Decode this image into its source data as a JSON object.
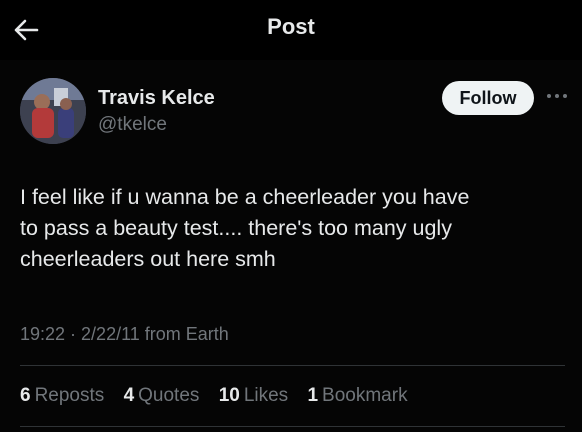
{
  "header": {
    "title": "Post",
    "back_icon": "arrow-left-icon"
  },
  "post": {
    "author": {
      "name": "Travis Kelce",
      "handle": "@tkelce"
    },
    "follow_label": "Follow",
    "more_icon": "more-horizontal-icon",
    "text": "I feel like if u wanna be a cheerleader you have\nto pass a beauty test.... there's too many ugly\ncheerleaders out here smh",
    "meta": "19:22 · 2/22/11 from Earth",
    "stats": {
      "reposts_count": "6",
      "reposts_label": "Reposts",
      "quotes_count": "4",
      "quotes_label": "Quotes",
      "likes_count": "10",
      "likes_label": "Likes",
      "bookmarks_count": "1",
      "bookmarks_label": "Bookmark"
    }
  },
  "colors": {
    "background": "#000000",
    "text_primary": "#e7e9ea",
    "text_secondary": "#71767b",
    "divider": "#2f3336",
    "follow_bg": "#eff3f4"
  }
}
